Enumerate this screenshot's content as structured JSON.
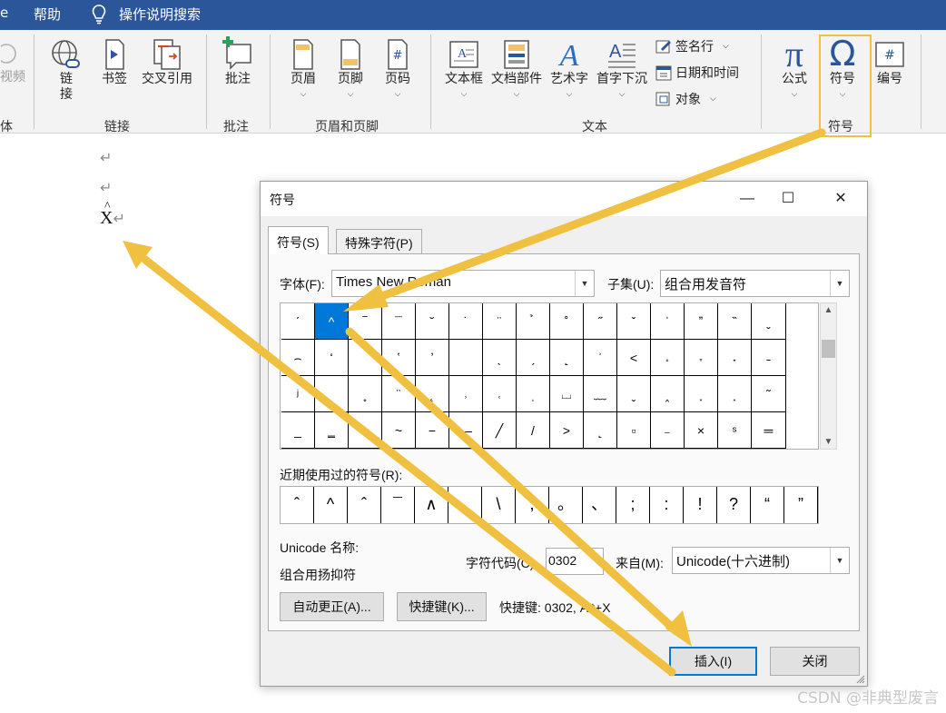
{
  "menubar": {
    "partial_tab": "e",
    "help": "帮助",
    "tell_me": "操作说明搜索"
  },
  "ribbon": {
    "partial_left_button": "视频",
    "partial_left_group": "体",
    "links_group": {
      "label": "链接",
      "link": "链\n接",
      "link_line1": "链",
      "link_line2": "接",
      "bookmark": "书签",
      "cross_ref": "交叉引用"
    },
    "comments_group": {
      "label": "批注",
      "comment": "批注"
    },
    "header_footer_group": {
      "label": "页眉和页脚",
      "header": "页眉",
      "footer": "页脚",
      "page_number": "页码"
    },
    "text_group": {
      "label": "文本",
      "textbox": "文本框",
      "quick_parts": "文档部件",
      "wordart": "艺术字",
      "drop_cap": "首字下沉",
      "signature_line": "签名行",
      "date_time": "日期和时间",
      "object": "对象"
    },
    "symbols_group": {
      "label": "符号",
      "equation": "公式",
      "symbol": "符号",
      "number": "编号"
    }
  },
  "document": {
    "inserted_char": "X",
    "hat": "^",
    "paragraph_mark": "↵"
  },
  "dialog": {
    "title": "符号",
    "tabs": [
      "符号(S)",
      "特殊字符(P)"
    ],
    "font_label": "字体(F):",
    "font_value": "Times New Roman",
    "subset_label": "子集(U):",
    "subset_value": "组合用发音符",
    "symbol_grid": [
      [
        "ˊ",
        "^",
        "‾",
        "¯",
        "˘",
        "˙",
        "¨",
        "̉",
        "˚",
        "˝",
        "ˇ",
        "ˈ",
        "ˮ",
        "̏",
        "ˬ"
      ],
      [
        "⌢",
        "ʻ",
        "",
        "ʽ",
        "ʼ",
        "",
        "ˎ",
        "ˏ",
        "˻",
        "ʾ",
        "˂",
        "˔",
        "˕",
        "˖",
        "˗"
      ],
      [
        "ʲ",
        "",
        "˳",
        "¨",
        "˛",
        "˒",
        "˓",
        "ˌ",
        "⌴",
        "﹏",
        "ˬ",
        "‸",
        "˯",
        "˰",
        "˜"
      ],
      [
        "_",
        "‗",
        "=",
        "~",
        "−",
        "—",
        "╱",
        "/",
        "˃",
        "˻",
        "▫",
        "₋",
        "×",
        "ˢ",
        "═"
      ]
    ],
    "recent_label": "近期使用过的符号(R):",
    "recent_symbols": [
      "ˆ",
      "^",
      "ˆ",
      "¯",
      "∧",
      "、",
      "\\",
      ",",
      "。",
      "、",
      ";",
      ":",
      "!",
      "?",
      "“",
      "”"
    ],
    "unicode_name_label": "Unicode 名称:",
    "unicode_name_value": "组合用扬抑符",
    "char_code_label": "字符代码(C):",
    "char_code_value": "0302",
    "from_label": "来自(M):",
    "from_value": "Unicode(十六进制)",
    "autocorrect_button": "自动更正(A)...",
    "shortcut_key_button": "快捷键(K)...",
    "shortcut_text": "快捷键: 0302, Alt+X",
    "insert_button": "插入(I)",
    "close_button": "关闭"
  },
  "watermark": "CSDN @非典型废言",
  "colors": {
    "menubar": "#2b579a",
    "selection": "#0078d7",
    "arrow": "#f0c040",
    "accent_icon": "#2b579a"
  }
}
